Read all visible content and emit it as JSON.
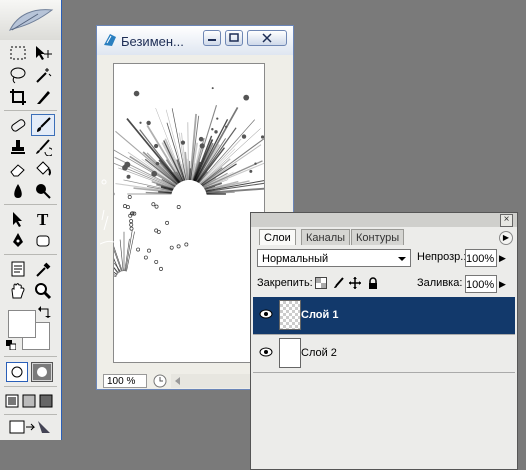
{
  "toolbox": {
    "tools": [
      "rect-marquee",
      "move",
      "lasso",
      "magic-wand",
      "crop",
      "slice",
      "healing-brush",
      "brush",
      "clone-stamp",
      "history-brush",
      "eraser",
      "paint-bucket",
      "blur",
      "dodge",
      "path-select",
      "type",
      "pen",
      "shape",
      "notes",
      "eyedropper",
      "hand",
      "zoom"
    ],
    "active_tool": "brush",
    "foreground_color": "#ffffff",
    "background_color": "#ffffff"
  },
  "document": {
    "title": "Безимен...",
    "zoom": "100 %"
  },
  "layers_panel": {
    "tabs": [
      {
        "label": "Слои",
        "active": true
      },
      {
        "label": "Каналы",
        "active": false
      },
      {
        "label": "Контуры",
        "active": false
      }
    ],
    "blend_mode": "Нормальный",
    "opacity_label": "Непрозр.:",
    "opacity_value": "100%",
    "lock_label": "Закрепить:",
    "fill_label": "Заливка:",
    "fill_value": "100%",
    "layers": [
      {
        "name": "Слой 1",
        "selected": true,
        "visible": true,
        "thumb": "transparent"
      },
      {
        "name": "Слой 2",
        "selected": false,
        "visible": true,
        "thumb": "white"
      }
    ]
  },
  "colors": {
    "workspace": "#7a7a7a",
    "selection": "#12396b",
    "titlebar_text": "#1d2d55"
  }
}
